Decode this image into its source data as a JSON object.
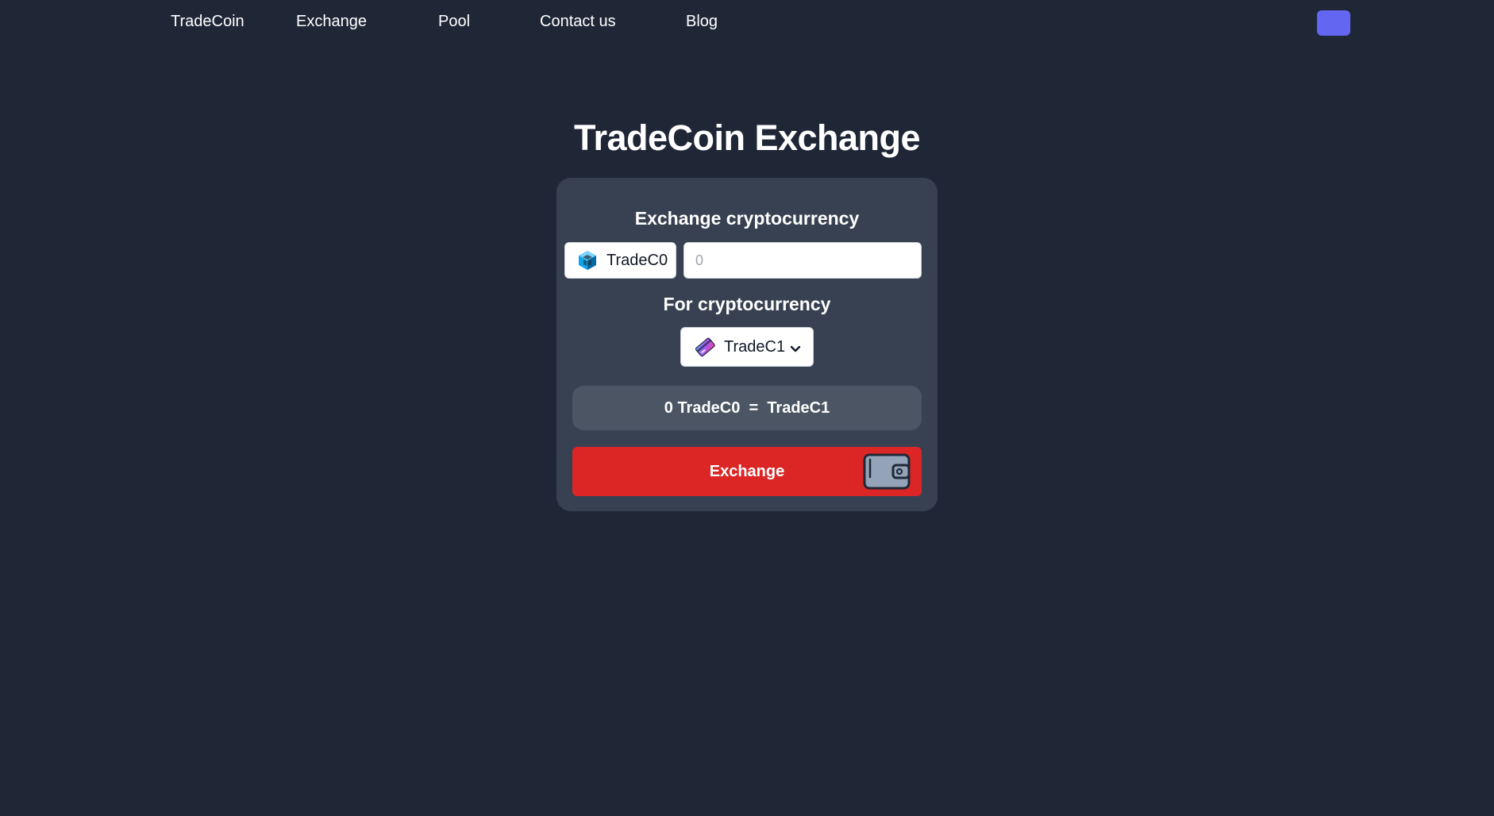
{
  "nav": {
    "links": [
      {
        "label": "TradeCoin"
      },
      {
        "label": "Exchange"
      },
      {
        "label": "Pool"
      },
      {
        "label": "Contact us"
      },
      {
        "label": "Blog"
      }
    ],
    "button_color": "#6366f1"
  },
  "main": {
    "title": "TradeCoin Exchange",
    "from_label": "Exchange cryptocurrency",
    "from_token": {
      "name": "TradeC0",
      "icon": "cube-icon"
    },
    "amount_placeholder": "0",
    "to_label": "For cryptocurrency",
    "to_token": {
      "name": "TradeC1",
      "icon": "crypto-card-icon"
    },
    "rate": {
      "amount": "0",
      "from": "TradeC0",
      "equals": "=",
      "to": "TradeC1"
    },
    "exchange_button": {
      "label": "Exchange",
      "icon": "wallet-icon",
      "color": "#dc2626"
    }
  },
  "colors": {
    "background": "#1f2737",
    "card": "#374151",
    "rate_box": "#4b5563"
  }
}
